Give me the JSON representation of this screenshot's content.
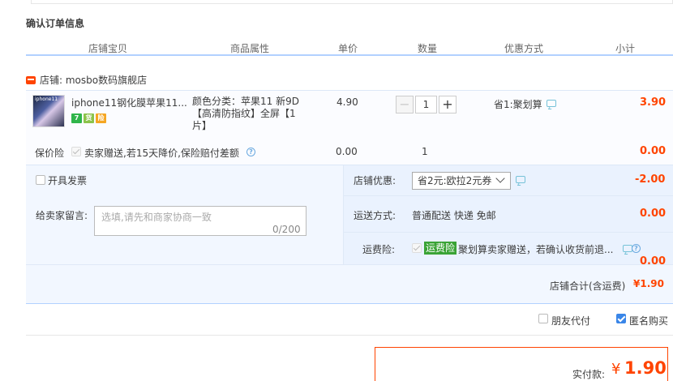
{
  "section_title": "确认订单信息",
  "columns": {
    "item": "店铺宝贝",
    "attr": "商品属性",
    "price": "单价",
    "qty": "数量",
    "promo": "优惠方式",
    "subtotal": "小计"
  },
  "shop": {
    "label": "店铺: mosbo数码旗舰店"
  },
  "item": {
    "thumb_text": "iphone11",
    "title": "iphone11钢化膜苹果11...",
    "attr_line1": "颜色分类：苹果11 新9D",
    "attr_line2": "【高清防指纹】全屏【1",
    "attr_line3": "片】",
    "price": "4.90",
    "qty": "1",
    "qty_minus": "−",
    "qty_plus": "+",
    "promo": "省1:聚划算",
    "subtotal": "3.90",
    "badges": [
      {
        "label": "7",
        "color": "#2fb54a"
      },
      {
        "label": "货",
        "color": "#8bc34a"
      },
      {
        "label": "险",
        "color": "#f5a623"
      }
    ]
  },
  "insurance": {
    "label": "保价险",
    "desc": "卖家赠送,若15天降价,保险赔付差额",
    "price": "0.00",
    "qty": "1",
    "subtotal": "0.00"
  },
  "invoice": {
    "label": "开具发票"
  },
  "shop_discount": {
    "label": "店铺优惠:",
    "selected": "省2元:欧拉2元券",
    "amount": "-2.00"
  },
  "message": {
    "label": "给卖家留言:",
    "placeholder": "选填,请先和商家协商一致",
    "count": "0/200"
  },
  "shipping": {
    "label": "运送方式:",
    "value": "普通配送 快递 免邮",
    "amount": "0.00"
  },
  "freight_insurance": {
    "label": "运费险:",
    "tag": "运费险",
    "desc": "聚划算卖家赠送，若确认收货前退...",
    "amount": "0.00"
  },
  "shop_total": {
    "label": "店铺合计(含运费)",
    "amount": "¥1.90"
  },
  "options": {
    "friend_pay": "朋友代付",
    "anonymous": "匿名购买"
  },
  "pay": {
    "label": "实付款:",
    "currency": "¥",
    "amount": "1.90"
  }
}
